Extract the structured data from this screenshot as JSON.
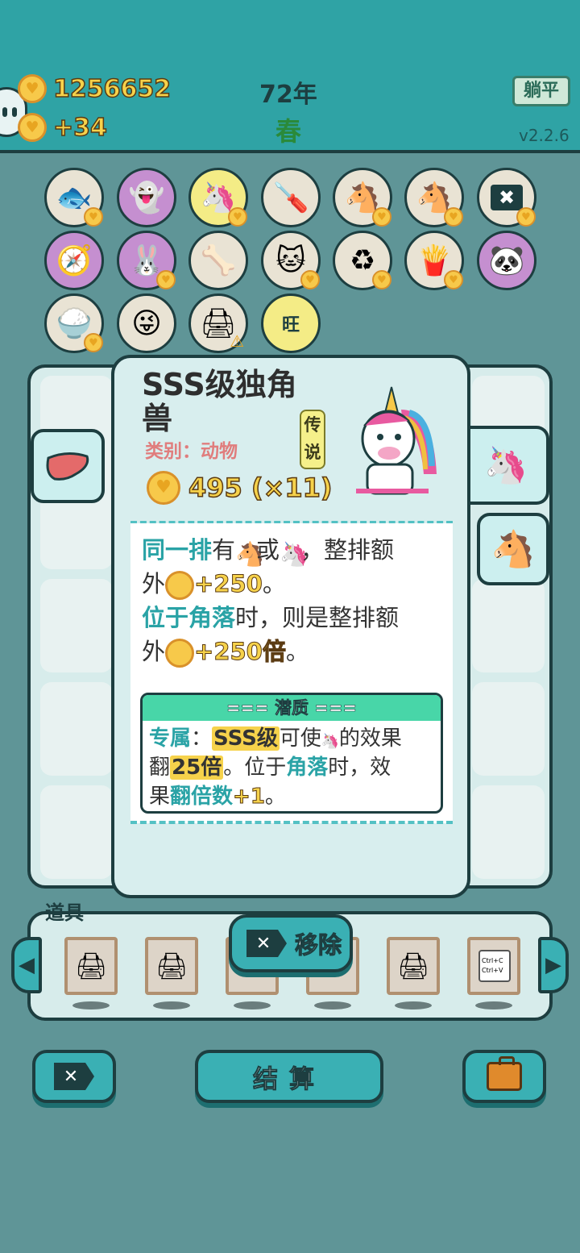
{
  "header": {
    "coins": "1256652",
    "income": "+34",
    "year": "72年",
    "season": "春",
    "lie_flat_label": "躺平",
    "version": "v2.2.6"
  },
  "grid_icons": [
    {
      "name": "fishbowl-icon",
      "bg": "#e9e3d4",
      "glyph": "🐟",
      "badge": "heart"
    },
    {
      "name": "ghost-icon",
      "bg": "#c58fd0",
      "glyph": "👻",
      "badge": ""
    },
    {
      "name": "unicorn-icon",
      "bg": "#f4ec86",
      "glyph": "🦄",
      "badge": "heart"
    },
    {
      "name": "screwdriver-icon",
      "bg": "#e9e3d4",
      "glyph": "🪛",
      "badge": ""
    },
    {
      "name": "horse-pair-icon",
      "bg": "#e9e3d4",
      "glyph": "🐴",
      "badge": "heart"
    },
    {
      "name": "horse-pair-2-icon",
      "bg": "#e9e3d4",
      "glyph": "🐴",
      "badge": "heart"
    },
    {
      "name": "remove-tag-icon",
      "bg": "#e9e3d4",
      "glyph": "✖",
      "badge": "heart"
    },
    {
      "name": "compass-icon",
      "bg": "#c58fd0",
      "glyph": "🧭",
      "badge": ""
    },
    {
      "name": "rabbit-icon",
      "bg": "#c58fd0",
      "glyph": "🐰",
      "badge": "heart"
    },
    {
      "name": "pet-bowl-icon",
      "bg": "#e9e3d4",
      "glyph": "🦴",
      "badge": ""
    },
    {
      "name": "cat-icon",
      "bg": "#e9e3d4",
      "glyph": "🐱",
      "badge": "heart"
    },
    {
      "name": "recycle-icon",
      "bg": "#e9e3d4",
      "glyph": "♻",
      "badge": "heart"
    },
    {
      "name": "fries-icon",
      "bg": "#e9e3d4",
      "glyph": "🍟",
      "badge": "heart"
    },
    {
      "name": "panda-icon",
      "bg": "#c58fd0",
      "glyph": "🐼",
      "badge": ""
    },
    {
      "name": "rice-bowl-icon",
      "bg": "#e9e3d4",
      "glyph": "🍚",
      "badge": "heart"
    },
    {
      "name": "ghost-tongue-icon",
      "bg": "#e9e3d4",
      "glyph": "😜",
      "badge": ""
    },
    {
      "name": "printer-icon",
      "bg": "#e9e3d4",
      "glyph": "🖨",
      "badge": "warn"
    },
    {
      "name": "wang-text-icon",
      "bg": "#f4ec86",
      "glyph": "旺",
      "badge": ""
    }
  ],
  "detail": {
    "title": "SSS级独角兽",
    "category": "类别：动物",
    "rarity": "传说",
    "price": "495 (×11)",
    "desc": {
      "l1_kw": "同一排",
      "l1_a": "有",
      "l1_b": "或",
      "l1_c": "，整排额",
      "l2_a": "外",
      "l2_bonus": "+250",
      "l2_end": "。",
      "l3_kw": "位于角落",
      "l3_a": "时，则是整排额",
      "l4_a": "外",
      "l4_bonus": "+250倍",
      "l4_end": "。"
    },
    "potential": {
      "header": "=== 潜质 ===",
      "kw_exclusive": "专属",
      "colon": "：",
      "sss": "SSS级",
      "t1": "可使",
      "t2": "的效果",
      "t3": "翻",
      "x25": "25倍",
      "t4": "。位于",
      "corner": "角落",
      "t5": "时，效",
      "t6": "果",
      "double": "翻倍数",
      "plus1": "+1",
      "t7": "。"
    }
  },
  "tools": {
    "label": "道具",
    "remove_label": "移除",
    "slots": [
      "printer",
      "printer",
      "copy-paste",
      "item",
      "printer",
      "ctrl-c-ctrl-v"
    ],
    "ctrl_text": "Ctrl+C\nCtrl+V"
  },
  "bottom": {
    "settle_label": "结算"
  },
  "colors": {
    "teal": "#2fa3a5",
    "accent": "#2aa3a6",
    "gold": "#f6d24b",
    "dark": "#1d3e40"
  }
}
